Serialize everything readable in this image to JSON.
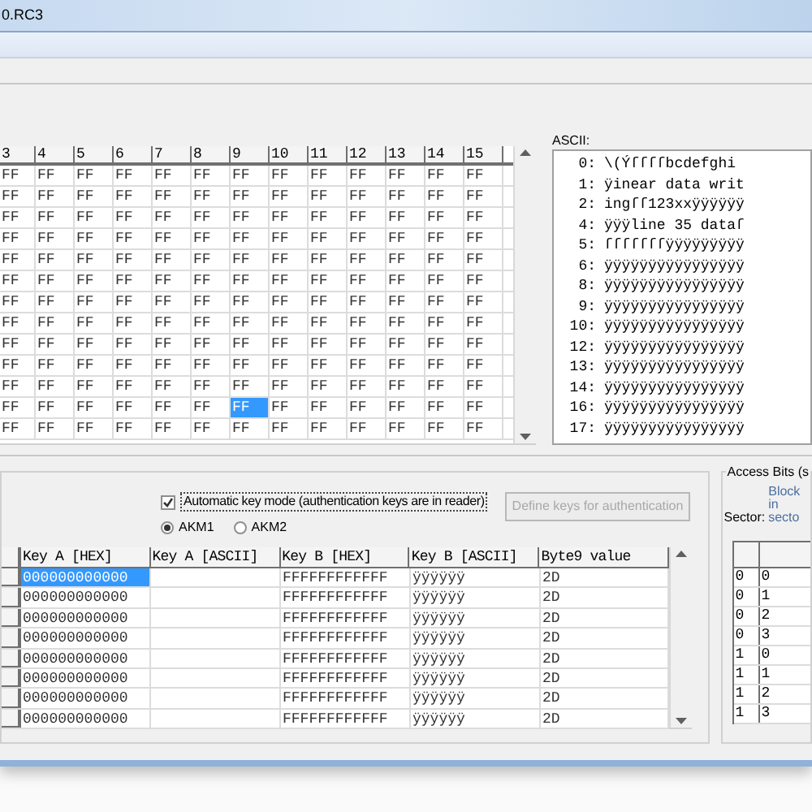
{
  "window": {
    "title": "0.RC3"
  },
  "hex_grid": {
    "columns": [
      "3",
      "4",
      "5",
      "6",
      "7",
      "8",
      "9",
      "10",
      "11",
      "12",
      "13",
      "14",
      "15"
    ],
    "rows": [
      {
        "cells": [
          {
            "value": "FF",
            "selected": false
          },
          {
            "value": "FF",
            "selected": false
          },
          {
            "value": "FF",
            "selected": false
          },
          {
            "value": "FF",
            "selected": false
          },
          {
            "value": "FF",
            "selected": false
          },
          {
            "value": "FF",
            "selected": false
          },
          {
            "value": "FF",
            "selected": false
          },
          {
            "value": "FF",
            "selected": false
          },
          {
            "value": "FF",
            "selected": false
          },
          {
            "value": "FF",
            "selected": false
          },
          {
            "value": "FF",
            "selected": false
          },
          {
            "value": "FF",
            "selected": false
          },
          {
            "value": "FF",
            "selected": false
          }
        ]
      },
      {
        "cells": [
          {
            "value": "FF",
            "selected": false
          },
          {
            "value": "FF",
            "selected": false
          },
          {
            "value": "FF",
            "selected": false
          },
          {
            "value": "FF",
            "selected": false
          },
          {
            "value": "FF",
            "selected": false
          },
          {
            "value": "FF",
            "selected": false
          },
          {
            "value": "FF",
            "selected": false
          },
          {
            "value": "FF",
            "selected": false
          },
          {
            "value": "FF",
            "selected": false
          },
          {
            "value": "FF",
            "selected": false
          },
          {
            "value": "FF",
            "selected": false
          },
          {
            "value": "FF",
            "selected": false
          },
          {
            "value": "FF",
            "selected": false
          }
        ]
      },
      {
        "cells": [
          {
            "value": "FF",
            "selected": false
          },
          {
            "value": "FF",
            "selected": false
          },
          {
            "value": "FF",
            "selected": false
          },
          {
            "value": "FF",
            "selected": false
          },
          {
            "value": "FF",
            "selected": false
          },
          {
            "value": "FF",
            "selected": false
          },
          {
            "value": "FF",
            "selected": false
          },
          {
            "value": "FF",
            "selected": false
          },
          {
            "value": "FF",
            "selected": false
          },
          {
            "value": "FF",
            "selected": false
          },
          {
            "value": "FF",
            "selected": false
          },
          {
            "value": "FF",
            "selected": false
          },
          {
            "value": "FF",
            "selected": false
          }
        ]
      },
      {
        "cells": [
          {
            "value": "FF",
            "selected": false
          },
          {
            "value": "FF",
            "selected": false
          },
          {
            "value": "FF",
            "selected": false
          },
          {
            "value": "FF",
            "selected": false
          },
          {
            "value": "FF",
            "selected": false
          },
          {
            "value": "FF",
            "selected": false
          },
          {
            "value": "FF",
            "selected": false
          },
          {
            "value": "FF",
            "selected": false
          },
          {
            "value": "FF",
            "selected": false
          },
          {
            "value": "FF",
            "selected": false
          },
          {
            "value": "FF",
            "selected": false
          },
          {
            "value": "FF",
            "selected": false
          },
          {
            "value": "FF",
            "selected": false
          }
        ]
      },
      {
        "cells": [
          {
            "value": "FF",
            "selected": false
          },
          {
            "value": "FF",
            "selected": false
          },
          {
            "value": "FF",
            "selected": false
          },
          {
            "value": "FF",
            "selected": false
          },
          {
            "value": "FF",
            "selected": false
          },
          {
            "value": "FF",
            "selected": false
          },
          {
            "value": "FF",
            "selected": false
          },
          {
            "value": "FF",
            "selected": false
          },
          {
            "value": "FF",
            "selected": false
          },
          {
            "value": "FF",
            "selected": false
          },
          {
            "value": "FF",
            "selected": false
          },
          {
            "value": "FF",
            "selected": false
          },
          {
            "value": "FF",
            "selected": false
          }
        ]
      },
      {
        "cells": [
          {
            "value": "FF",
            "selected": false
          },
          {
            "value": "FF",
            "selected": false
          },
          {
            "value": "FF",
            "selected": false
          },
          {
            "value": "FF",
            "selected": false
          },
          {
            "value": "FF",
            "selected": false
          },
          {
            "value": "FF",
            "selected": false
          },
          {
            "value": "FF",
            "selected": false
          },
          {
            "value": "FF",
            "selected": false
          },
          {
            "value": "FF",
            "selected": false
          },
          {
            "value": "FF",
            "selected": false
          },
          {
            "value": "FF",
            "selected": false
          },
          {
            "value": "FF",
            "selected": false
          },
          {
            "value": "FF",
            "selected": false
          }
        ]
      },
      {
        "cells": [
          {
            "value": "FF",
            "selected": false
          },
          {
            "value": "FF",
            "selected": false
          },
          {
            "value": "FF",
            "selected": false
          },
          {
            "value": "FF",
            "selected": false
          },
          {
            "value": "FF",
            "selected": false
          },
          {
            "value": "FF",
            "selected": false
          },
          {
            "value": "FF",
            "selected": false
          },
          {
            "value": "FF",
            "selected": false
          },
          {
            "value": "FF",
            "selected": false
          },
          {
            "value": "FF",
            "selected": false
          },
          {
            "value": "FF",
            "selected": false
          },
          {
            "value": "FF",
            "selected": false
          },
          {
            "value": "FF",
            "selected": false
          }
        ]
      },
      {
        "cells": [
          {
            "value": "FF",
            "selected": false
          },
          {
            "value": "FF",
            "selected": false
          },
          {
            "value": "FF",
            "selected": false
          },
          {
            "value": "FF",
            "selected": false
          },
          {
            "value": "FF",
            "selected": false
          },
          {
            "value": "FF",
            "selected": false
          },
          {
            "value": "FF",
            "selected": false
          },
          {
            "value": "FF",
            "selected": false
          },
          {
            "value": "FF",
            "selected": false
          },
          {
            "value": "FF",
            "selected": false
          },
          {
            "value": "FF",
            "selected": false
          },
          {
            "value": "FF",
            "selected": false
          },
          {
            "value": "FF",
            "selected": false
          }
        ]
      },
      {
        "cells": [
          {
            "value": "FF",
            "selected": false
          },
          {
            "value": "FF",
            "selected": false
          },
          {
            "value": "FF",
            "selected": false
          },
          {
            "value": "FF",
            "selected": false
          },
          {
            "value": "FF",
            "selected": false
          },
          {
            "value": "FF",
            "selected": false
          },
          {
            "value": "FF",
            "selected": false
          },
          {
            "value": "FF",
            "selected": false
          },
          {
            "value": "FF",
            "selected": false
          },
          {
            "value": "FF",
            "selected": false
          },
          {
            "value": "FF",
            "selected": false
          },
          {
            "value": "FF",
            "selected": false
          },
          {
            "value": "FF",
            "selected": false
          }
        ]
      },
      {
        "cells": [
          {
            "value": "FF",
            "selected": false
          },
          {
            "value": "FF",
            "selected": false
          },
          {
            "value": "FF",
            "selected": false
          },
          {
            "value": "FF",
            "selected": false
          },
          {
            "value": "FF",
            "selected": false
          },
          {
            "value": "FF",
            "selected": false
          },
          {
            "value": "FF",
            "selected": false
          },
          {
            "value": "FF",
            "selected": false
          },
          {
            "value": "FF",
            "selected": false
          },
          {
            "value": "FF",
            "selected": false
          },
          {
            "value": "FF",
            "selected": false
          },
          {
            "value": "FF",
            "selected": false
          },
          {
            "value": "FF",
            "selected": false
          }
        ]
      },
      {
        "cells": [
          {
            "value": "FF",
            "selected": false
          },
          {
            "value": "FF",
            "selected": false
          },
          {
            "value": "FF",
            "selected": false
          },
          {
            "value": "FF",
            "selected": false
          },
          {
            "value": "FF",
            "selected": false
          },
          {
            "value": "FF",
            "selected": false
          },
          {
            "value": "FF",
            "selected": false
          },
          {
            "value": "FF",
            "selected": false
          },
          {
            "value": "FF",
            "selected": false
          },
          {
            "value": "FF",
            "selected": false
          },
          {
            "value": "FF",
            "selected": false
          },
          {
            "value": "FF",
            "selected": false
          },
          {
            "value": "FF",
            "selected": false
          }
        ]
      },
      {
        "cells": [
          {
            "value": "FF",
            "selected": false
          },
          {
            "value": "FF",
            "selected": false
          },
          {
            "value": "FF",
            "selected": false
          },
          {
            "value": "FF",
            "selected": false
          },
          {
            "value": "FF",
            "selected": false
          },
          {
            "value": "FF",
            "selected": false
          },
          {
            "value": "FF",
            "selected": true
          },
          {
            "value": "FF",
            "selected": false
          },
          {
            "value": "FF",
            "selected": false
          },
          {
            "value": "FF",
            "selected": false
          },
          {
            "value": "FF",
            "selected": false
          },
          {
            "value": "FF",
            "selected": false
          },
          {
            "value": "FF",
            "selected": false
          }
        ]
      },
      {
        "cells": [
          {
            "value": "FF",
            "selected": false
          },
          {
            "value": "FF",
            "selected": false
          },
          {
            "value": "FF",
            "selected": false
          },
          {
            "value": "FF",
            "selected": false
          },
          {
            "value": "FF",
            "selected": false
          },
          {
            "value": "FF",
            "selected": false
          },
          {
            "value": "FF",
            "selected": false
          },
          {
            "value": "FF",
            "selected": false
          },
          {
            "value": "FF",
            "selected": false
          },
          {
            "value": "FF",
            "selected": false
          },
          {
            "value": "FF",
            "selected": false
          },
          {
            "value": "FF",
            "selected": false
          },
          {
            "value": "FF",
            "selected": false
          }
        ]
      }
    ]
  },
  "ascii_panel": {
    "label": "ASCII:",
    "lines": [
      {
        "index": "0:",
        "text": "\\(Ýſſſſbcdefghi"
      },
      {
        "index": "1:",
        "text": "ÿinear data writ"
      },
      {
        "index": "2:",
        "text": "ingſſ123xxÿÿÿÿÿÿ"
      },
      {
        "index": "4:",
        "text": "ÿÿÿline 35 dataſ"
      },
      {
        "index": "5:",
        "text": "ſſſſſſſÿÿÿÿÿÿÿÿÿ"
      },
      {
        "index": "6:",
        "text": "ÿÿÿÿÿÿÿÿÿÿÿÿÿÿÿÿ"
      },
      {
        "index": "8:",
        "text": "ÿÿÿÿÿÿÿÿÿÿÿÿÿÿÿÿ"
      },
      {
        "index": "9:",
        "text": "ÿÿÿÿÿÿÿÿÿÿÿÿÿÿÿÿ"
      },
      {
        "index": "10:",
        "text": "ÿÿÿÿÿÿÿÿÿÿÿÿÿÿÿÿ"
      },
      {
        "index": "12:",
        "text": "ÿÿÿÿÿÿÿÿÿÿÿÿÿÿÿÿ"
      },
      {
        "index": "13:",
        "text": "ÿÿÿÿÿÿÿÿÿÿÿÿÿÿÿÿ"
      },
      {
        "index": "14:",
        "text": "ÿÿÿÿÿÿÿÿÿÿÿÿÿÿÿÿ"
      },
      {
        "index": "16:",
        "text": "ÿÿÿÿÿÿÿÿÿÿÿÿÿÿÿÿ"
      },
      {
        "index": "17:",
        "text": "ÿÿÿÿÿÿÿÿÿÿÿÿÿÿÿÿ"
      }
    ]
  },
  "keys": {
    "automatic_key_mode": {
      "label": "Automatic key mode (authentication keys are in reader)",
      "checked": true
    },
    "modes": [
      {
        "label": "AKM1",
        "selected": true
      },
      {
        "label": "AKM2",
        "selected": false
      }
    ],
    "define_button": {
      "label": "Define keys for authentication",
      "disabled": true
    },
    "table": {
      "columns": [
        "Key A [HEX]",
        "Key A [ASCII]",
        "Key B [HEX]",
        "Key B [ASCII]",
        "Byte9 value"
      ],
      "rows": [
        {
          "key_a_hex": "000000000000",
          "key_a_ascii": "",
          "key_b_hex": "FFFFFFFFFFFF",
          "key_b_ascii": "ÿÿÿÿÿÿ",
          "byte9": "2D",
          "selected": true
        },
        {
          "key_a_hex": "000000000000",
          "key_a_ascii": "",
          "key_b_hex": "FFFFFFFFFFFF",
          "key_b_ascii": "ÿÿÿÿÿÿ",
          "byte9": "2D",
          "selected": false
        },
        {
          "key_a_hex": "000000000000",
          "key_a_ascii": "",
          "key_b_hex": "FFFFFFFFFFFF",
          "key_b_ascii": "ÿÿÿÿÿÿ",
          "byte9": "2D",
          "selected": false
        },
        {
          "key_a_hex": "000000000000",
          "key_a_ascii": "",
          "key_b_hex": "FFFFFFFFFFFF",
          "key_b_ascii": "ÿÿÿÿÿÿ",
          "byte9": "2D",
          "selected": false
        },
        {
          "key_a_hex": "000000000000",
          "key_a_ascii": "",
          "key_b_hex": "FFFFFFFFFFFF",
          "key_b_ascii": "ÿÿÿÿÿÿ",
          "byte9": "2D",
          "selected": false
        },
        {
          "key_a_hex": "000000000000",
          "key_a_ascii": "",
          "key_b_hex": "FFFFFFFFFFFF",
          "key_b_ascii": "ÿÿÿÿÿÿ",
          "byte9": "2D",
          "selected": false
        },
        {
          "key_a_hex": "000000000000",
          "key_a_ascii": "",
          "key_b_hex": "FFFFFFFFFFFF",
          "key_b_ascii": "ÿÿÿÿÿÿ",
          "byte9": "2D",
          "selected": false
        },
        {
          "key_a_hex": "000000000000",
          "key_a_ascii": "",
          "key_b_hex": "FFFFFFFFFFFF",
          "key_b_ascii": "ÿÿÿÿÿÿ",
          "byte9": "2D",
          "selected": false
        }
      ]
    }
  },
  "access_bits": {
    "title": "Access Bits (s",
    "block_label_lines": [
      "Block",
      "in",
      "secto"
    ],
    "sector_label": "Sector:",
    "rows": [
      {
        "sector": "0",
        "block": "0"
      },
      {
        "sector": "0",
        "block": "1"
      },
      {
        "sector": "0",
        "block": "2"
      },
      {
        "sector": "0",
        "block": "3"
      },
      {
        "sector": "1",
        "block": "0"
      },
      {
        "sector": "1",
        "block": "1"
      },
      {
        "sector": "1",
        "block": "2"
      },
      {
        "sector": "1",
        "block": "3"
      }
    ]
  }
}
